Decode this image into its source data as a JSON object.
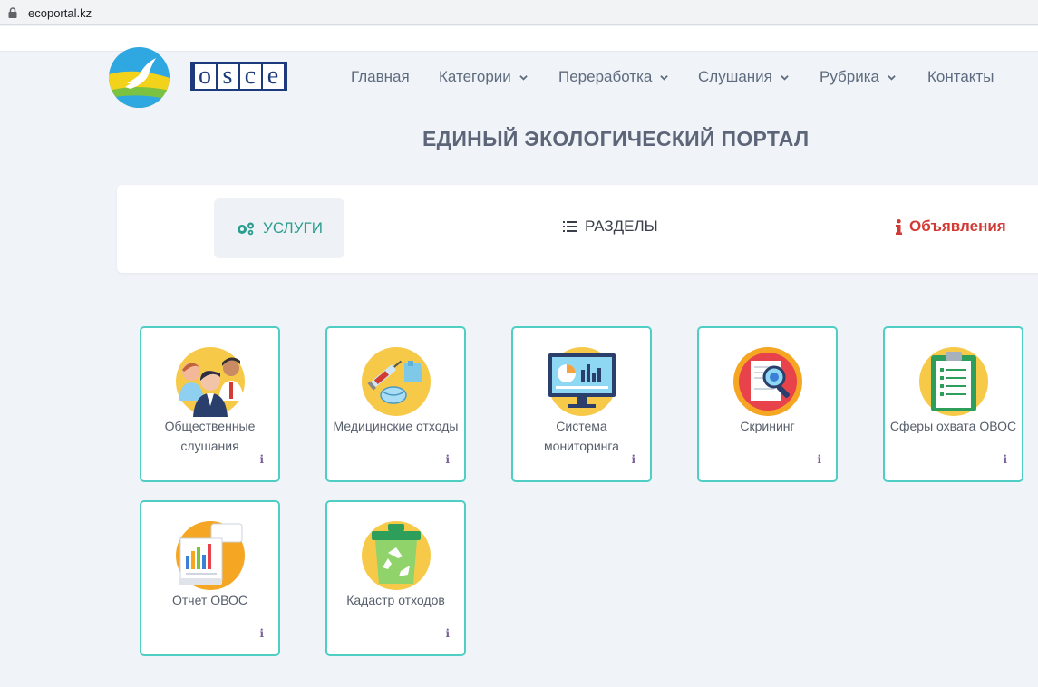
{
  "browser": {
    "url": "ecoportal.kz"
  },
  "header": {
    "osce_letters": [
      "o",
      "s",
      "c",
      "e"
    ],
    "nav": [
      {
        "label": "Главная",
        "dropdown": false
      },
      {
        "label": "Категории",
        "dropdown": true
      },
      {
        "label": "Переработка",
        "dropdown": true
      },
      {
        "label": "Слушания",
        "dropdown": true
      },
      {
        "label": "Рубрика",
        "dropdown": true
      },
      {
        "label": "Контакты",
        "dropdown": false
      }
    ]
  },
  "page_title": "ЕДИНЫЙ ЭКОЛОГИЧЕСКИЙ ПОРТАЛ",
  "tabs": {
    "services": "УСЛУГИ",
    "sections": "РАЗДЕЛЫ",
    "announcements": "Объявления"
  },
  "colors": {
    "accent": "#2a9d8f",
    "card_border": "#4fcfc4",
    "alert": "#d23a34",
    "background": "#f0f4f8"
  },
  "cards": [
    {
      "label": "Общественные слушания",
      "icon": "people-icon",
      "info": "i"
    },
    {
      "label": "Медицинские отходы",
      "icon": "medical-waste-icon",
      "info": "i"
    },
    {
      "label": "Система мониторинга",
      "icon": "monitor-icon",
      "info": "i"
    },
    {
      "label": "Скрининг",
      "icon": "magnifier-icon",
      "info": "i"
    },
    {
      "label": "Сферы охвата ОВОС",
      "icon": "clipboard-icon",
      "info": "i"
    },
    {
      "label": "Отчет ОВОС",
      "icon": "report-icon",
      "info": "i"
    },
    {
      "label": "Кадастр отходов",
      "icon": "recycle-bin-icon",
      "info": "i"
    }
  ]
}
